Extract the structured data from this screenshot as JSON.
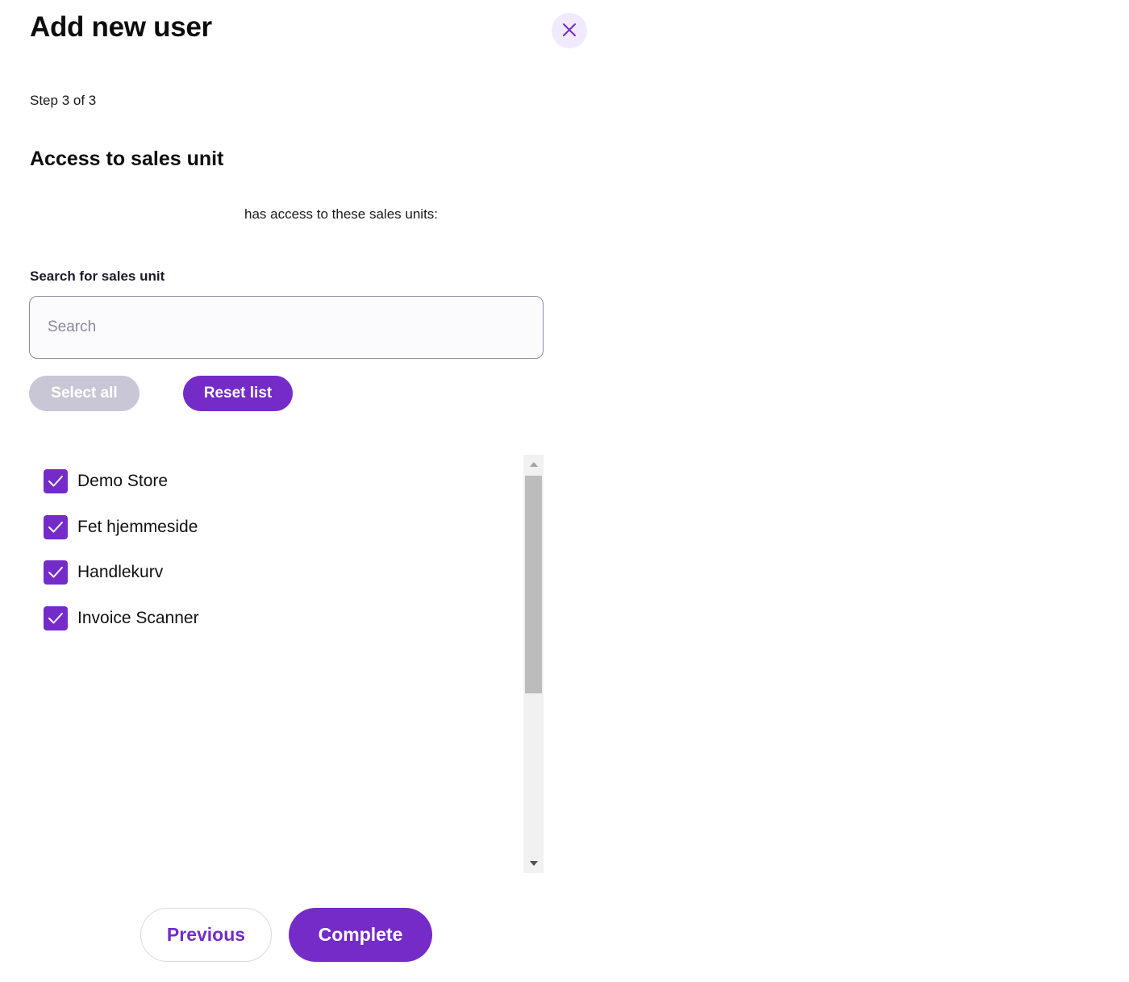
{
  "dialog": {
    "title": "Add new user",
    "close_icon": "close-icon",
    "step": "Step 3 of 3",
    "section_title": "Access to sales unit",
    "access_text": "has access to these sales units:"
  },
  "search": {
    "label": "Search for sales unit",
    "placeholder": "Search",
    "value": ""
  },
  "actions": {
    "select_all_label": "Select all",
    "select_all_disabled": true,
    "reset_list_label": "Reset list"
  },
  "sales_units": [
    {
      "label": "Demo Store",
      "checked": true
    },
    {
      "label": "Fet hjemmeside",
      "checked": true
    },
    {
      "label": "Handlekurv",
      "checked": true
    },
    {
      "label": "Invoice Scanner",
      "checked": true
    }
  ],
  "footer": {
    "previous_label": "Previous",
    "complete_label": "Complete"
  },
  "colors": {
    "accent": "#742bc8",
    "disabled": "#c9c6d6",
    "close_bg": "#f0eafc"
  }
}
